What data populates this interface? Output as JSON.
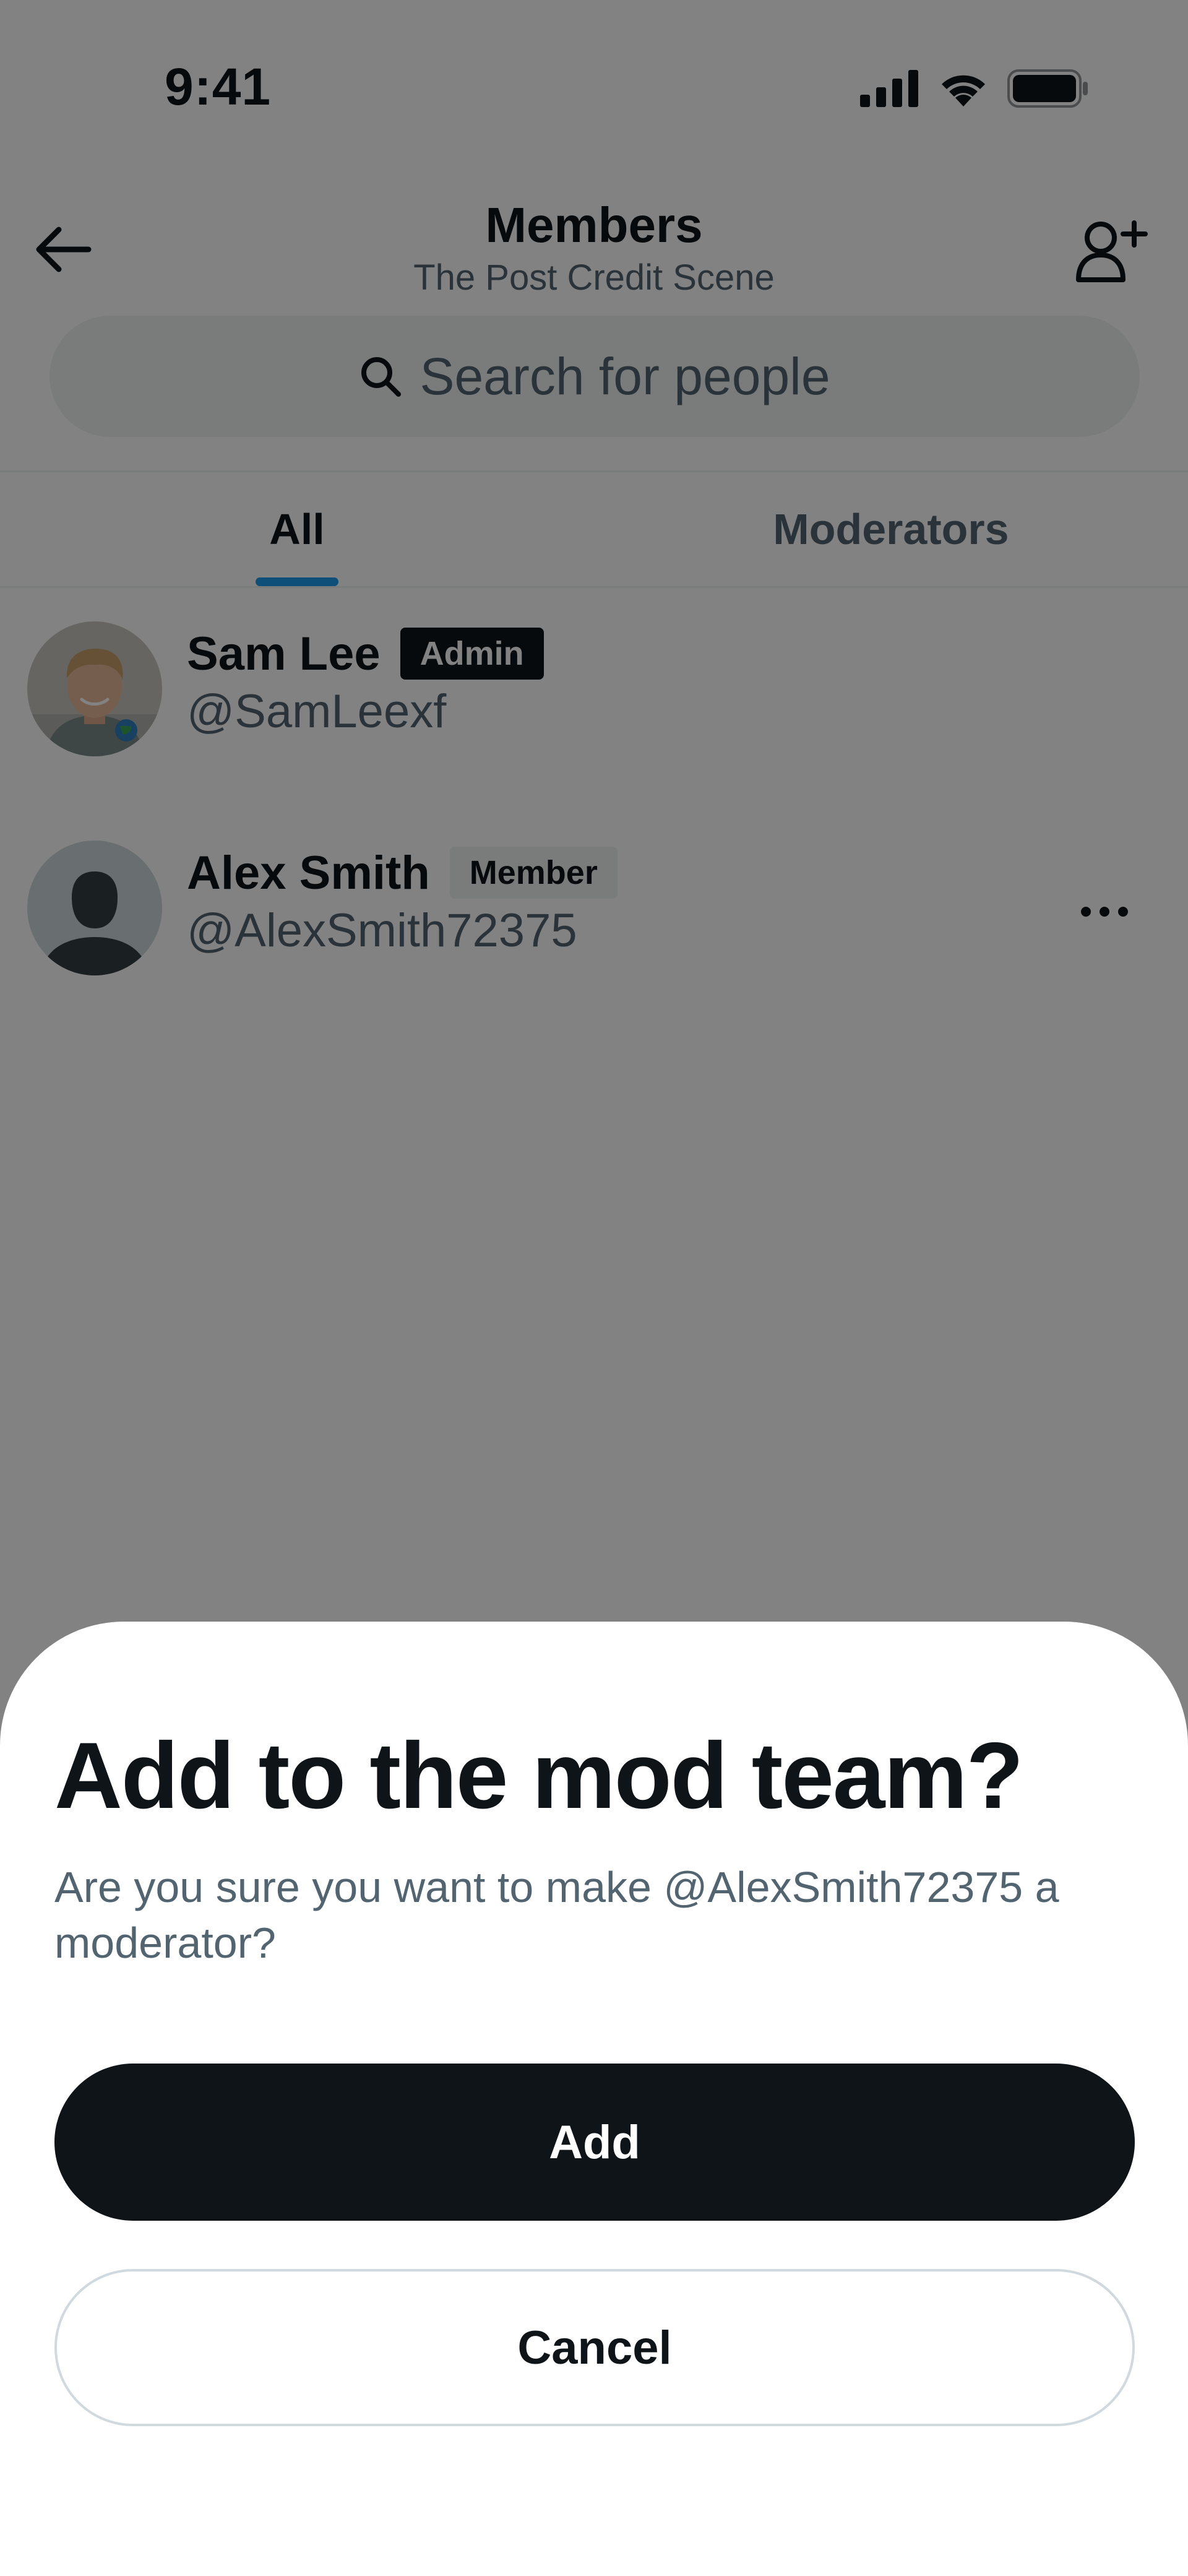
{
  "status_bar": {
    "time": "9:41",
    "icons": [
      "cellular-signal-icon",
      "wifi-icon",
      "battery-icon"
    ]
  },
  "header": {
    "title": "Members",
    "subtitle": "The Post Credit Scene",
    "back_icon": "arrow-left-icon",
    "add_member_icon": "add-person-icon"
  },
  "search": {
    "placeholder": "Search for people",
    "icon": "search-icon"
  },
  "tabs": [
    {
      "label": "All",
      "active": true
    },
    {
      "label": "Moderators",
      "active": false
    }
  ],
  "members": [
    {
      "name": "Sam Lee",
      "role": "Admin",
      "handle": "@SamLeexf",
      "avatar": "photo-avatar"
    },
    {
      "name": "Alex Smith",
      "role": "Member",
      "handle": "@AlexSmith72375",
      "avatar": "default-avatar",
      "more_icon": "more-horizontal-icon"
    }
  ],
  "dialog": {
    "title": "Add to the mod team?",
    "description": "Are you sure you want to make @AlexSmith72375 a moderator?",
    "confirm_label": "Add",
    "cancel_label": "Cancel"
  },
  "colors": {
    "primary_text": "#0f1419",
    "secondary_text": "#536471",
    "accent": "#1d9bf0",
    "overlay": "rgba(0,0,0,0.49)"
  }
}
